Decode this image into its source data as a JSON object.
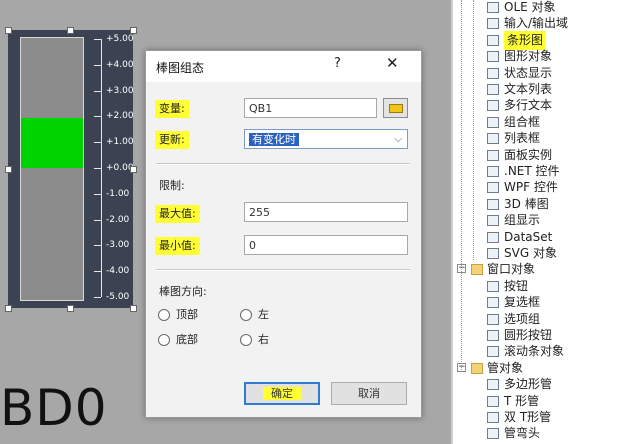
{
  "canvas": {
    "bar_value": 1.95,
    "bar_origin": 0,
    "scale_min": -5,
    "scale_max": 5,
    "scale_labels": [
      "+5.00",
      "+4.00",
      "+3.00",
      "+2.00",
      "+1.00",
      "+0.00",
      "-1.00",
      "-2.00",
      "-3.00",
      "-4.00",
      "-5.00"
    ],
    "bar_color": "#00d400",
    "big_text": "BD0"
  },
  "dialog": {
    "title": "棒图组态",
    "help_label": "?",
    "close_label": "✕",
    "variable_label": "变量:",
    "variable_value": "QB1",
    "update_label": "更新:",
    "update_value": "有变化时",
    "limits_label": "限制:",
    "max_label": "最大值:",
    "max_value": "255",
    "min_label": "最小值:",
    "min_value": "0",
    "direction_label": "棒图方向:",
    "directions": [
      {
        "label": "顶部",
        "selected": true
      },
      {
        "label": "左",
        "selected": false
      },
      {
        "label": "底部",
        "selected": false
      },
      {
        "label": "右",
        "selected": false
      }
    ],
    "ok_label": "确定",
    "cancel_label": "取消"
  },
  "tree": {
    "items": [
      {
        "label": "OLE 对象",
        "icon": "ole-icon"
      },
      {
        "label": "输入/输出域",
        "icon": "io-field-icon"
      },
      {
        "label": "条形图",
        "icon": "bar-graph-icon",
        "highlighted": true
      },
      {
        "label": "图形对象",
        "icon": "graphic-object-icon"
      },
      {
        "label": "状态显示",
        "icon": "status-display-icon"
      },
      {
        "label": "文本列表",
        "icon": "text-list-icon"
      },
      {
        "label": "多行文本",
        "icon": "multiline-text-icon"
      },
      {
        "label": "组合框",
        "icon": "combo-box-icon"
      },
      {
        "label": "列表框",
        "icon": "list-box-icon"
      },
      {
        "label": "面板实例",
        "icon": "faceplate-icon"
      },
      {
        "label": ".NET 控件",
        "icon": "net-control-icon"
      },
      {
        "label": "WPF 控件",
        "icon": "wpf-control-icon"
      },
      {
        "label": "3D 棒图",
        "icon": "bar-3d-icon"
      },
      {
        "label": "组显示",
        "icon": "group-display-icon"
      },
      {
        "label": "DataSet",
        "icon": "dataset-icon"
      },
      {
        "label": "SVG 对象",
        "icon": "svg-object-icon"
      },
      {
        "label": "窗口对象",
        "icon": "folder-icon",
        "group": true
      },
      {
        "label": "按钮",
        "icon": "button-icon"
      },
      {
        "label": "复选框",
        "icon": "checkbox-icon"
      },
      {
        "label": "选项组",
        "icon": "option-group-icon"
      },
      {
        "label": "圆形按钮",
        "icon": "round-button-icon"
      },
      {
        "label": "滚动条对象",
        "icon": "slider-icon"
      },
      {
        "label": "管对象",
        "icon": "folder-icon",
        "group": true
      },
      {
        "label": "多边形管",
        "icon": "polygon-tube-icon"
      },
      {
        "label": "T 形管",
        "icon": "t-piece-icon"
      },
      {
        "label": "双 T形管",
        "icon": "double-t-piece-icon"
      },
      {
        "label": "管弯头",
        "icon": "tube-bend-icon"
      }
    ]
  }
}
